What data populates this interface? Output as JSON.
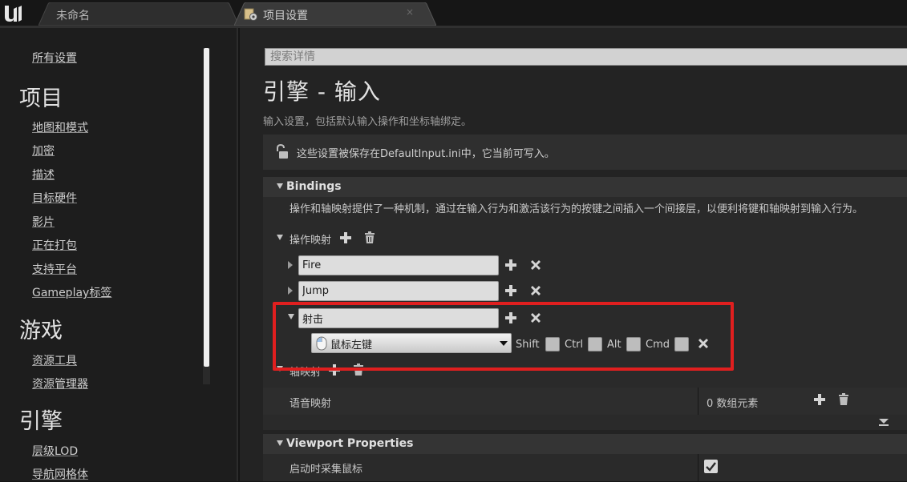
{
  "tabs": [
    {
      "label": "未命名"
    },
    {
      "label": "项目设置",
      "close": "×"
    }
  ],
  "sidebar": {
    "all_settings": "所有设置",
    "project_header": "项目",
    "project_items": [
      "地图和模式",
      "加密",
      "描述",
      "目标硬件",
      "影片",
      "正在打包",
      "支持平台",
      "Gameplay标签"
    ],
    "game_header": "游戏",
    "game_items": [
      "资源工具",
      "资源管理器"
    ],
    "engine_header": "引擎",
    "engine_items": [
      "层级LOD",
      "导航网格体"
    ]
  },
  "main": {
    "search_placeholder": "搜索详情",
    "title": "引擎 - 输入",
    "subtitle": "输入设置，包括默认输入操作和坐标轴绑定。",
    "notice": "这些设置被保存在DefaultInput.ini中，它当前可写入。",
    "bindings": {
      "title": "Bindings",
      "description": "操作和轴映射提供了一种机制，通过在输入行为和激活该行为的按键之间插入一个间接层，以便利将键和轴映射到输入行为。",
      "action_mappings_label": "操作映射",
      "actions": [
        {
          "name": "Fire"
        },
        {
          "name": "Jump"
        },
        {
          "name": "射击"
        }
      ],
      "key": {
        "value": "鼠标左键",
        "modifiers": [
          "Shift",
          "Ctrl",
          "Alt",
          "Cmd"
        ]
      },
      "axis_mappings_label": "轴映射",
      "voice_mappings_label": "语音映射",
      "voice_mappings_value": "0 数组元素"
    },
    "viewport": {
      "title": "Viewport Properties",
      "capture_mouse_label": "启动时采集鼠标",
      "capture_mouse_checked": true
    }
  },
  "colors": {
    "highlight": "#e01f1f",
    "background": "#232323"
  }
}
